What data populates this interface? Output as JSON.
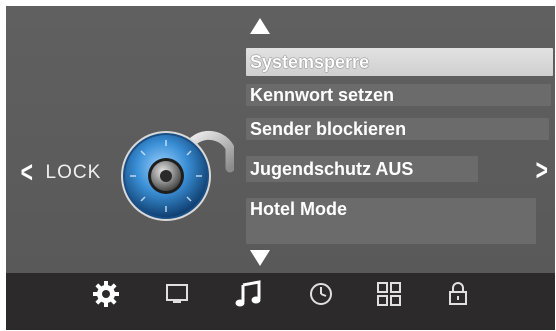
{
  "nav": {
    "left_arrow": "<",
    "left_label": "LOCK",
    "right_arrow": ">"
  },
  "menu": {
    "items": [
      {
        "label": "Systemsperre",
        "selected": true
      },
      {
        "label": "Kennwort setzen",
        "selected": false
      },
      {
        "label": "Sender blockieren",
        "selected": false
      },
      {
        "label": "Jugendschutz AUS",
        "selected": false
      },
      {
        "label": "Hotel Mode",
        "selected": false
      }
    ]
  },
  "bottom_icons": [
    "settings-gear-icon",
    "monitor-icon",
    "music-note-icon",
    "clock-icon",
    "grid-icon",
    "lock-icon"
  ],
  "colors": {
    "panel_bg": "#5c5c5c",
    "bottom_bar": "#2c2a2b",
    "selected_row": "#d7d7d7",
    "row_bg": "#6b6b6b",
    "lock_accent": "#3a8fd6"
  }
}
